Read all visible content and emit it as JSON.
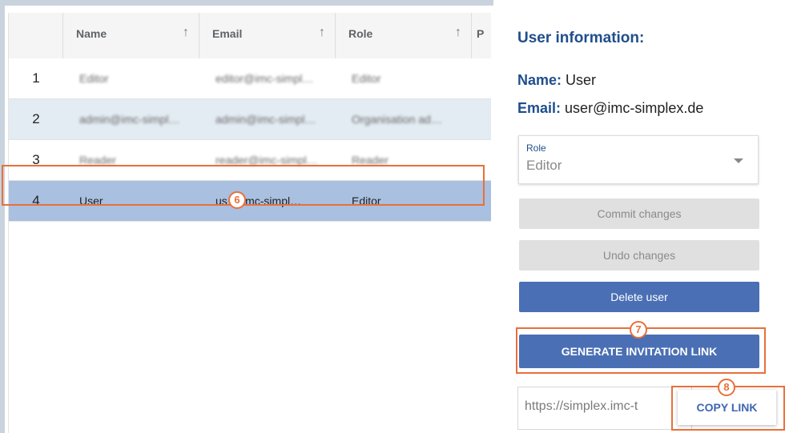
{
  "table": {
    "headers": [
      {
        "label": "Name",
        "arrow": "↑"
      },
      {
        "label": "Email",
        "arrow": "↑"
      },
      {
        "label": "Role",
        "arrow": "↑"
      },
      {
        "label": "P"
      }
    ],
    "rows": [
      {
        "num": "1",
        "name": "Editor",
        "email": "editor@imc-simpl…",
        "role": "Editor"
      },
      {
        "num": "2",
        "name": "admin@imc-simpl…",
        "email": "admin@imc-simpl…",
        "role": "Organisation ad…"
      },
      {
        "num": "3",
        "name": "Reader",
        "email": "reader@imc-simpl…",
        "role": "Reader"
      },
      {
        "num": "4",
        "name": "User",
        "email": "us",
        "email_tail": "imc-simpl…",
        "role": "Editor"
      }
    ]
  },
  "badges": {
    "six": "6",
    "seven": "7",
    "eight": "8"
  },
  "panel": {
    "title": "User information:",
    "name_key": "Name:",
    "name_value": "User",
    "email_key": "Email:",
    "email_value": "user@imc-simplex.de",
    "role_label": "Role",
    "role_value": "Editor",
    "commit_label": "Commit changes",
    "undo_label": "Undo changes",
    "delete_label": "Delete user",
    "generate_label": "GENERATE INVITATION LINK",
    "link_value": "https://simplex.imc-t",
    "copy_label": "COPY LINK"
  },
  "colors": {
    "accent": "#4a6fb5",
    "highlight": "#e8703a",
    "row_selected": "#a9c0e0",
    "row_alt": "#e3ebf3"
  }
}
